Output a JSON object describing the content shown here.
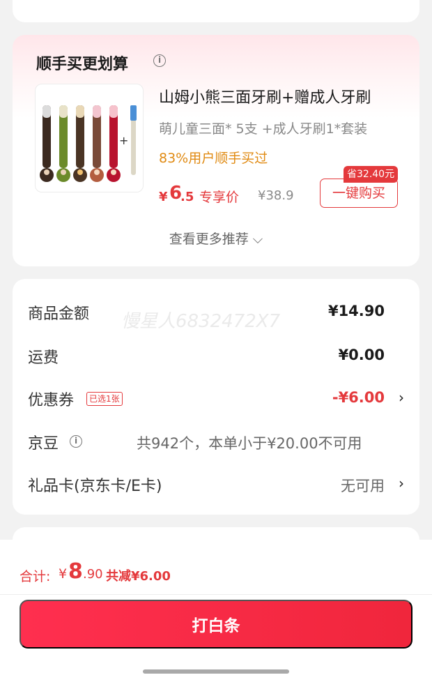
{
  "colors": {
    "accent": "#e4393c",
    "orange": "#e08a12",
    "background": "#f2f2f2"
  },
  "recommendation": {
    "title": "顺手买更划算",
    "info_icon": "info-circle-icon",
    "product": {
      "name": "山姆小熊三面牙刷+赠成人牙刷",
      "spec": "萌儿童三面* 5支 +成人牙刷1*套装",
      "buyers": "83%用户顺手买过",
      "price_yen": "¥",
      "price_int": "6",
      "price_dec": ".5",
      "price_tag": "专享价",
      "original_price": "¥38.9",
      "save_badge": "省32.40元",
      "buy_label": "一键购买"
    },
    "more_label": "查看更多推荐 ⌵"
  },
  "fees": {
    "watermark": "慢星人6832472X7",
    "rows": [
      {
        "label": "商品金额",
        "value": "¥14.90"
      },
      {
        "label": "运费",
        "value": "¥0.00"
      },
      {
        "label": "优惠券",
        "badge": "已选1张",
        "value": "-¥6.00"
      },
      {
        "label": "京豆",
        "note": "共942个，本单小于¥20.00不可用"
      },
      {
        "label": "礼品卡(京东卡/E卡)",
        "value": "无可用"
      }
    ],
    "chevron": "›"
  },
  "footer": {
    "total_label": "合计:",
    "total_yen": "¥",
    "total_int": "8",
    "total_dec": ".90",
    "saving": "共减¥6.00",
    "pay_label": "打白条"
  }
}
